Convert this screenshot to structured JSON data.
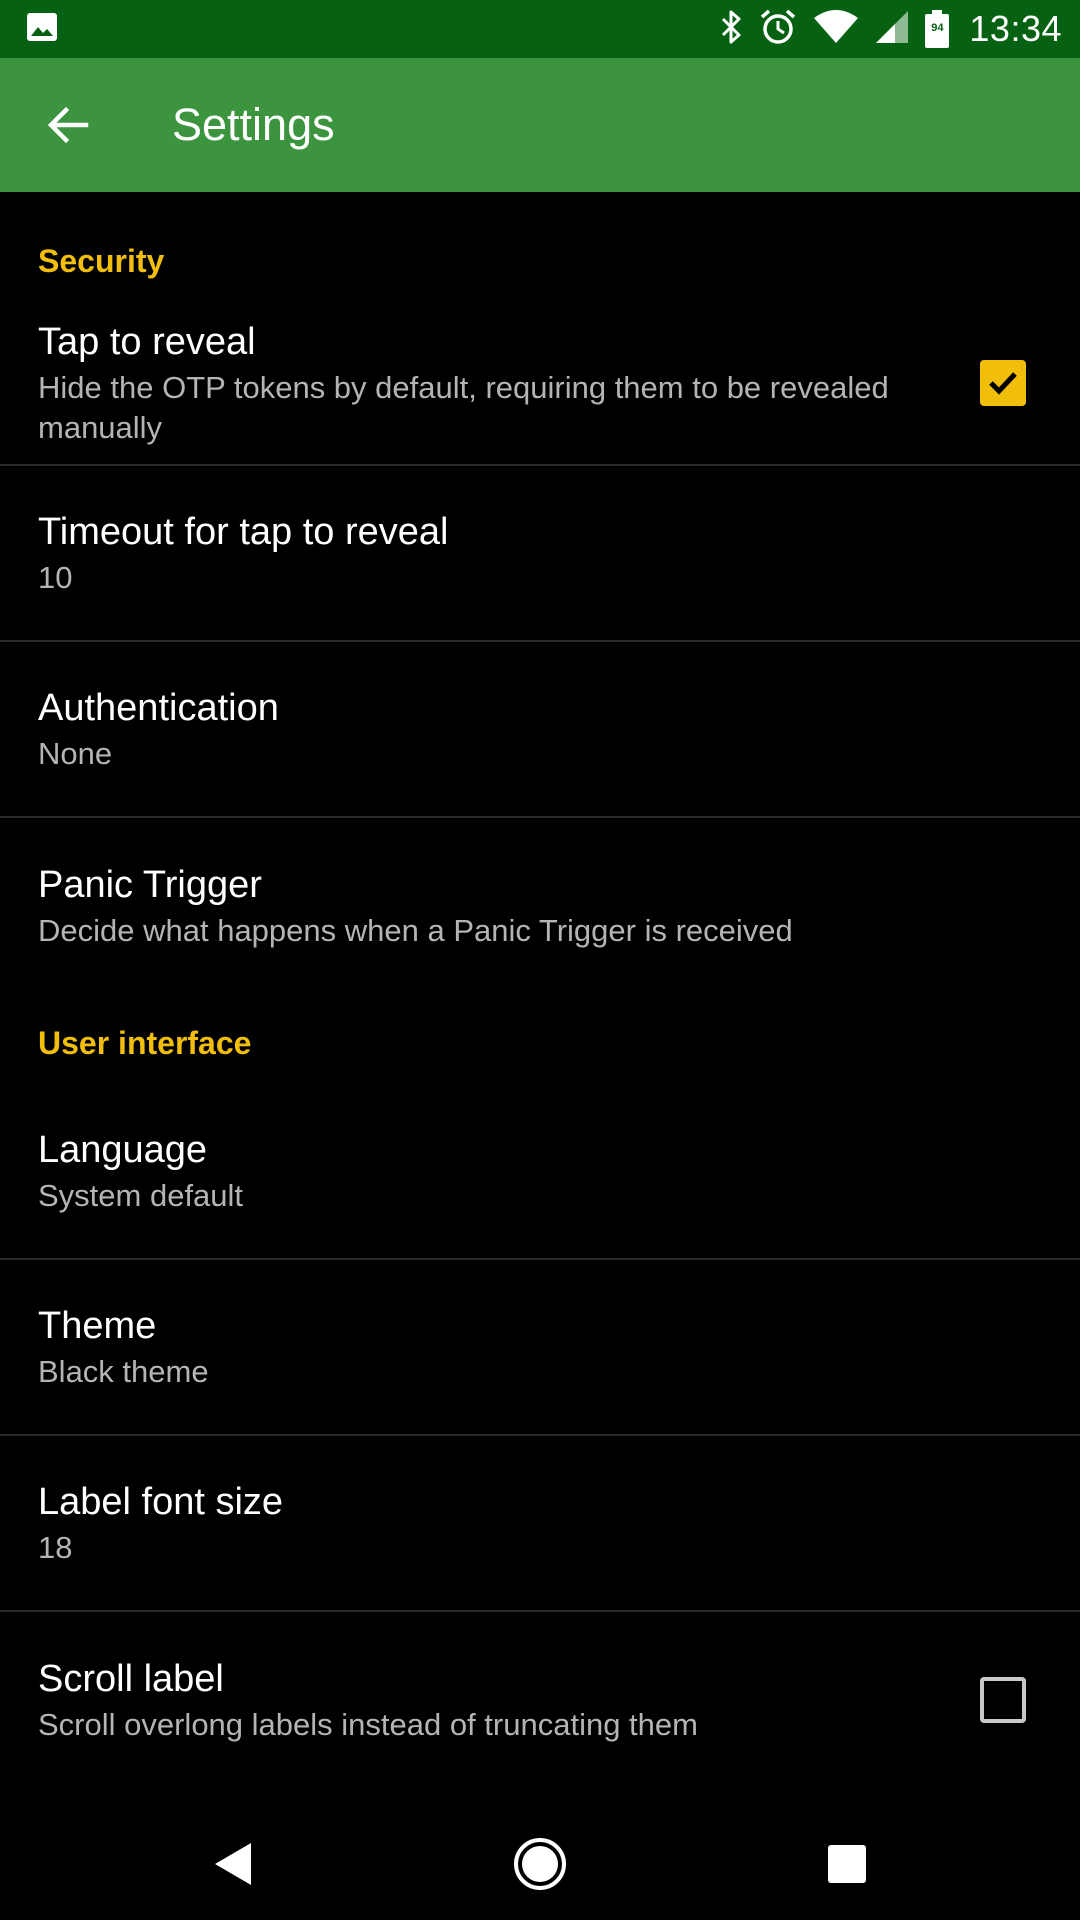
{
  "status_bar": {
    "time": "13:34",
    "battery_level": "94",
    "icons": [
      "image-notification-icon",
      "bluetooth-icon",
      "alarm-icon",
      "wifi-icon",
      "cell-signal-icon",
      "battery-icon"
    ]
  },
  "app_bar": {
    "title": "Settings",
    "back_icon": "arrow-back-icon"
  },
  "sections": {
    "security": {
      "header": "Security",
      "items": [
        {
          "title": "Tap to reveal",
          "summary": "Hide the OTP tokens by default, requiring them to be revealed manually",
          "checkbox": true
        },
        {
          "title": "Timeout for tap to reveal",
          "summary": "10"
        },
        {
          "title": "Authentication",
          "summary": "None"
        },
        {
          "title": "Panic Trigger",
          "summary": "Decide what happens when a Panic Trigger is received"
        }
      ]
    },
    "user_interface": {
      "header": "User interface",
      "items": [
        {
          "title": "Language",
          "summary": "System default"
        },
        {
          "title": "Theme",
          "summary": "Black theme"
        },
        {
          "title": "Label font size",
          "summary": "18"
        },
        {
          "title": "Scroll label",
          "summary": "Scroll overlong labels instead of truncating them",
          "checkbox": false
        }
      ]
    }
  },
  "nav_bar": {
    "icons": [
      "nav-back-icon",
      "nav-home-icon",
      "nav-recents-icon"
    ]
  },
  "colors": {
    "status_bar": "#066212",
    "app_bar": "#3d943f",
    "accent": "#f2be0c",
    "background": "#000000"
  }
}
